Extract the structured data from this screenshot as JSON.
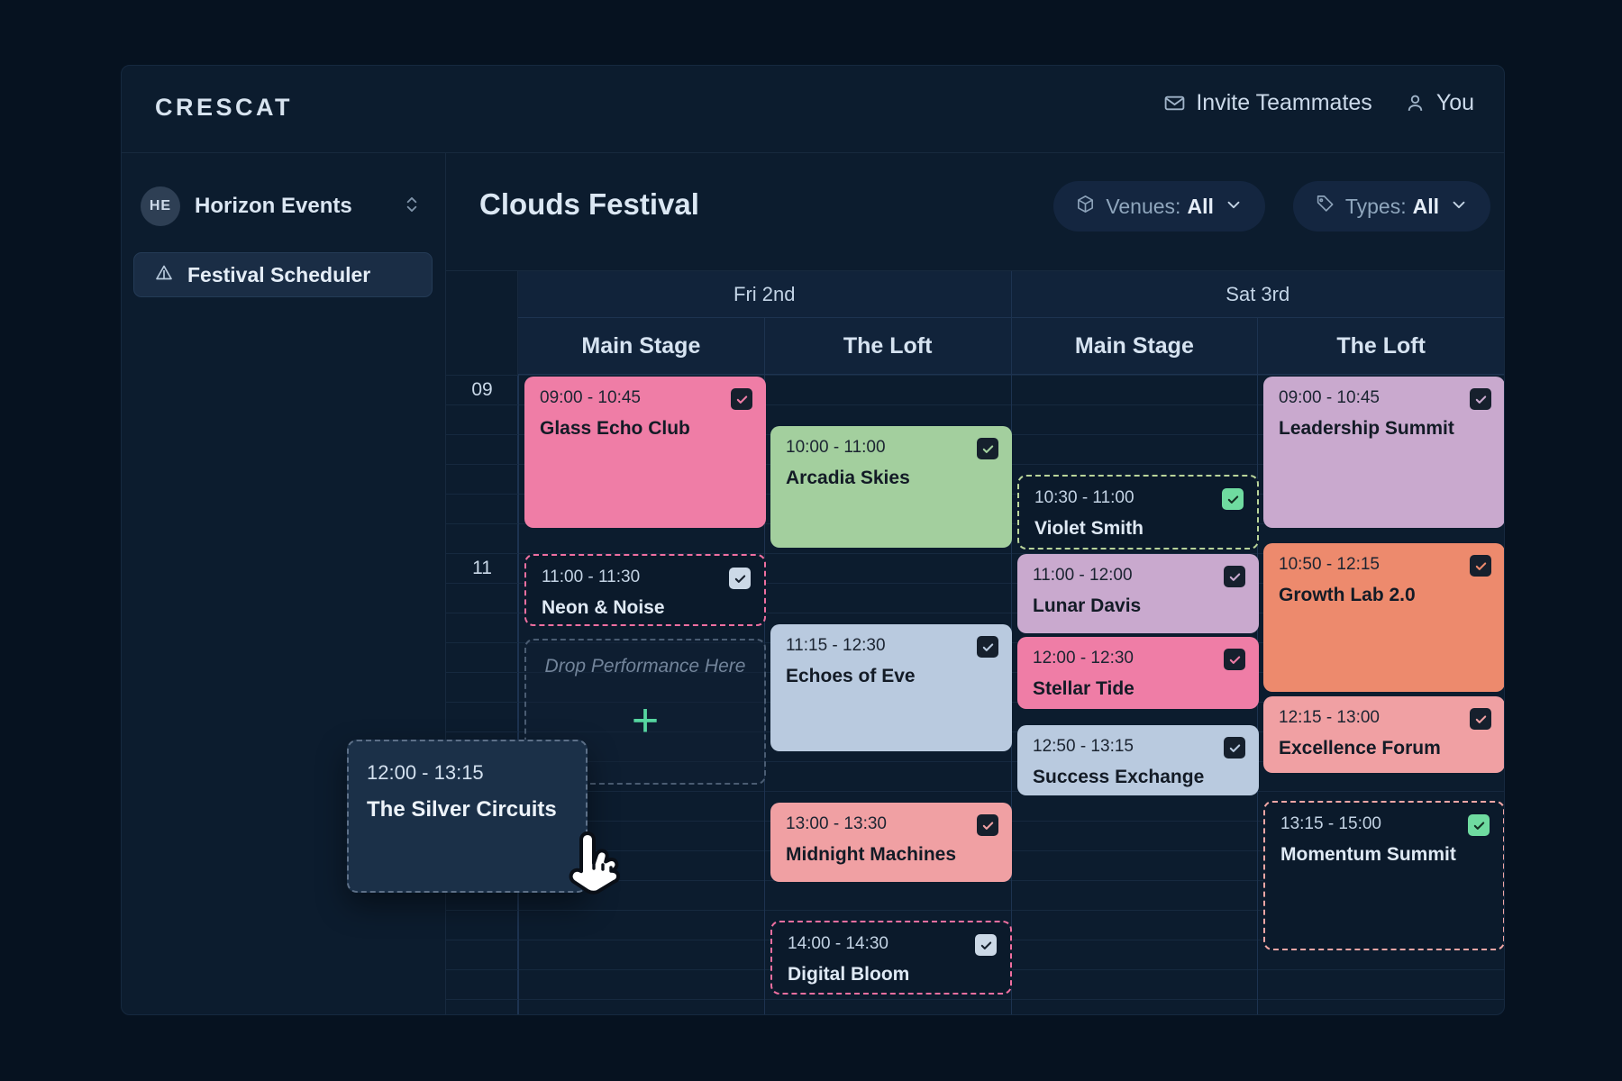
{
  "app": {
    "brand": "CRESCAT"
  },
  "topbar": {
    "invite_label": "Invite Teammates",
    "user_label": "You",
    "mail_icon": "mail-icon",
    "user_icon": "user-icon"
  },
  "sidebar": {
    "org": {
      "initials": "HE",
      "name": "Horizon Events",
      "chevron_icon": "chevron-updown-icon"
    },
    "nav": [
      {
        "label": "Festival Scheduler",
        "icon": "tent-icon",
        "active": true
      }
    ]
  },
  "main": {
    "title": "Clouds Festival",
    "filters": [
      {
        "id": "venues",
        "icon": "box-icon",
        "label": "Venues:",
        "value": "All",
        "chevron": "chevron-down-icon"
      },
      {
        "id": "types",
        "icon": "tag-icon",
        "label": "Types:",
        "value": "All",
        "chevron": "chevron-down-icon"
      }
    ]
  },
  "calendar": {
    "days": [
      {
        "label": "Fri 2nd",
        "venues": [
          "Main Stage",
          "The Loft"
        ]
      },
      {
        "label": "Sat 3rd",
        "venues": [
          "Main Stage",
          "The Loft"
        ]
      }
    ],
    "hour_labels": [
      "09",
      "11"
    ],
    "drop_zone": {
      "label": "Drop Performance Here",
      "plus_icon": "plus-icon"
    },
    "drag_card": {
      "time": "12:00 - 13:15",
      "name": "The Silver Circuits",
      "cursor_icon": "pointing-hand-cursor"
    },
    "columns": [
      {
        "day": "Fri 2nd",
        "venue": "Main Stage",
        "events": [
          {
            "time": "09:00 - 10:45",
            "name": "Glass Echo Club",
            "style": "solid",
            "color": "#ef7da6",
            "checked": true
          },
          {
            "time": "11:00 - 11:30",
            "name": "Neon & Noise",
            "style": "ghost",
            "color": "#ef6fa0",
            "checked": true,
            "check_style": "light"
          }
        ]
      },
      {
        "day": "Fri 2nd",
        "venue": "The Loft",
        "events": [
          {
            "time": "10:00 - 11:00",
            "name": "Arcadia Skies",
            "style": "solid",
            "color": "#a3cf9e",
            "checked": true
          },
          {
            "time": "11:15 - 12:30",
            "name": "Echoes of Eve",
            "style": "solid",
            "color": "#b9cadf",
            "checked": true
          },
          {
            "time": "13:00 - 13:30",
            "name": "Midnight Machines",
            "style": "solid",
            "color": "#f0a0a3",
            "checked": true
          },
          {
            "time": "14:00 - 14:30",
            "name": "Digital Bloom",
            "style": "ghost",
            "color": "#ef6fa0",
            "checked": true,
            "check_style": "light"
          }
        ]
      },
      {
        "day": "Sat 3rd",
        "venue": "Main Stage",
        "events": [
          {
            "time": "10:30 - 11:00",
            "name": "Violet Smith",
            "style": "ghost",
            "color": "#b9d49a",
            "checked": true,
            "check_style": "green"
          },
          {
            "time": "11:00 - 12:00",
            "name": "Lunar Davis",
            "style": "solid",
            "color": "#c9a9ce",
            "checked": true
          },
          {
            "time": "12:00 - 12:30",
            "name": "Stellar Tide",
            "style": "solid",
            "color": "#ef7da6",
            "checked": true
          },
          {
            "time": "12:50 - 13:15",
            "name": "Success Exchange",
            "style": "solid",
            "color": "#b9cadf",
            "checked": true
          }
        ]
      },
      {
        "day": "Sat 3rd",
        "venue": "The Loft",
        "events": [
          {
            "time": "09:00 - 10:45",
            "name": "Leadership Summit",
            "style": "solid",
            "color": "#c9a9ce",
            "checked": true
          },
          {
            "time": "10:50 - 12:15",
            "name": "Growth Lab 2.0",
            "style": "solid",
            "color": "#ed8a6d",
            "checked": true
          },
          {
            "time": "12:15 - 13:00",
            "name": "Excellence Forum",
            "style": "solid",
            "color": "#f0a0a3",
            "checked": true
          },
          {
            "time": "13:15 - 15:00",
            "name": "Momentum Summit",
            "style": "ghost",
            "color": "#f0a6a5",
            "checked": true,
            "check_style": "green"
          }
        ]
      }
    ]
  },
  "colors": {
    "page_bg": "#061220",
    "panel_bg": "#0c1c2e",
    "accent_green": "#56d6a0",
    "text_primary": "#dbe7f3",
    "text_muted": "#8fa6bd"
  }
}
